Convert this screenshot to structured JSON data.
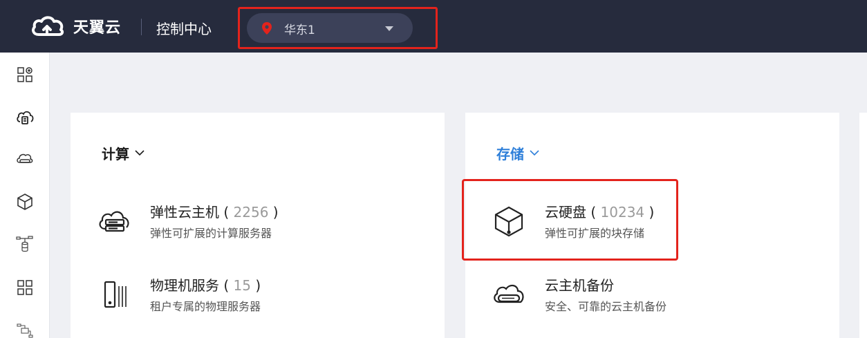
{
  "header": {
    "brand": "天翼云",
    "console_title": "控制中心",
    "region": {
      "label": "华东1"
    }
  },
  "sidebar": {
    "items": [
      {
        "icon": "apps-grid-icon"
      },
      {
        "icon": "cloud-server-icon"
      },
      {
        "icon": "cloud-disk-icon"
      },
      {
        "icon": "cube-icon"
      },
      {
        "icon": "database-network-icon"
      },
      {
        "icon": "grid-icon"
      },
      {
        "icon": "network-icon"
      }
    ]
  },
  "sections": {
    "compute": {
      "title": "计算",
      "items": [
        {
          "name": "弹性云主机",
          "count": "2256",
          "desc": "弹性可扩展的计算服务器",
          "icon": "cloud-server-icon"
        },
        {
          "name": "物理机服务",
          "count": "15",
          "desc": "租户专属的物理服务器",
          "icon": "physical-server-icon"
        }
      ]
    },
    "storage": {
      "title": "存储",
      "items": [
        {
          "name": "云硬盘",
          "count": "10234",
          "desc": "弹性可扩展的块存储",
          "icon": "cube-icon"
        },
        {
          "name": "云主机备份",
          "count": "",
          "desc": "安全、可靠的云主机备份",
          "icon": "cloud-backup-icon"
        }
      ]
    }
  },
  "colors": {
    "topbar": "#262b3d",
    "accent_blue": "#2e7fd9",
    "highlight_red": "#e3231c",
    "background": "#eff0f4"
  }
}
